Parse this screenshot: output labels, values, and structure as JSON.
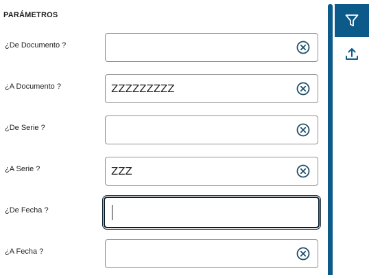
{
  "params": {
    "title": "PARÁMETROS",
    "fields": [
      {
        "label": "¿De Documento ?",
        "value": ""
      },
      {
        "label": "¿A Documento ?",
        "value": "ZZZZZZZZZ"
      },
      {
        "label": "¿De Serie ?",
        "value": ""
      },
      {
        "label": "¿A Serie ?",
        "value": "ZZZ"
      },
      {
        "label": "¿De Fecha ?",
        "value": ""
      },
      {
        "label": "¿A Fecha ?",
        "value": ""
      }
    ]
  },
  "toolbar": {
    "filter_icon": "filter-icon",
    "upload_icon": "upload-icon"
  },
  "colors": {
    "accent": "#0b5a8a",
    "focus_border": "#0d1f2d",
    "clear_icon": "#1f4e6b"
  }
}
